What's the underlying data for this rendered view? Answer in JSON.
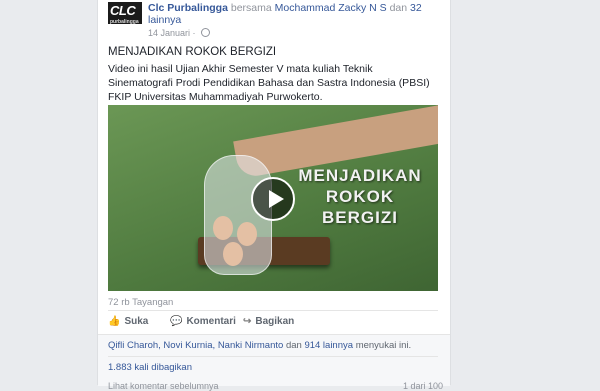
{
  "post": {
    "page_name": "Clc Purbalingga",
    "with_text": "bersama",
    "with_person": "Mochammad Zacky N S",
    "and_text": "dan",
    "others": "32 lainnya",
    "date": "14 Januari",
    "date_sep": "·",
    "avatar_text": "CLC",
    "avatar_sub": "purbalingga",
    "title": "MENJADIKAN ROKOK BERGIZI",
    "body": "Video ini hasil Ujian Akhir Semester V mata kuliah Teknik Sinematografi Prodi Pendidikan Bahasa dan Sastra Indonesia (PBSI) FKIP Universitas Muhammadiyah Purwokerto."
  },
  "video": {
    "overlay_line1": "MENJADIKAN",
    "overlay_line2": "ROKOK",
    "overlay_line3": "BERGIZI",
    "views": "72 rb Tayangan"
  },
  "actions": {
    "like": "Suka",
    "comment": "Komentari",
    "share": "Bagikan"
  },
  "reactions": {
    "names": "Qifli Charoh, Novi Kurnia, Nanki Nirmanto",
    "and_text": "dan",
    "others": "914 lainnya",
    "suffix": "menyukai ini.",
    "shares": "1.883 kali dibagikan",
    "more_left": "Lihat komentar sebelumnya",
    "more_right": "1 dari 100"
  }
}
